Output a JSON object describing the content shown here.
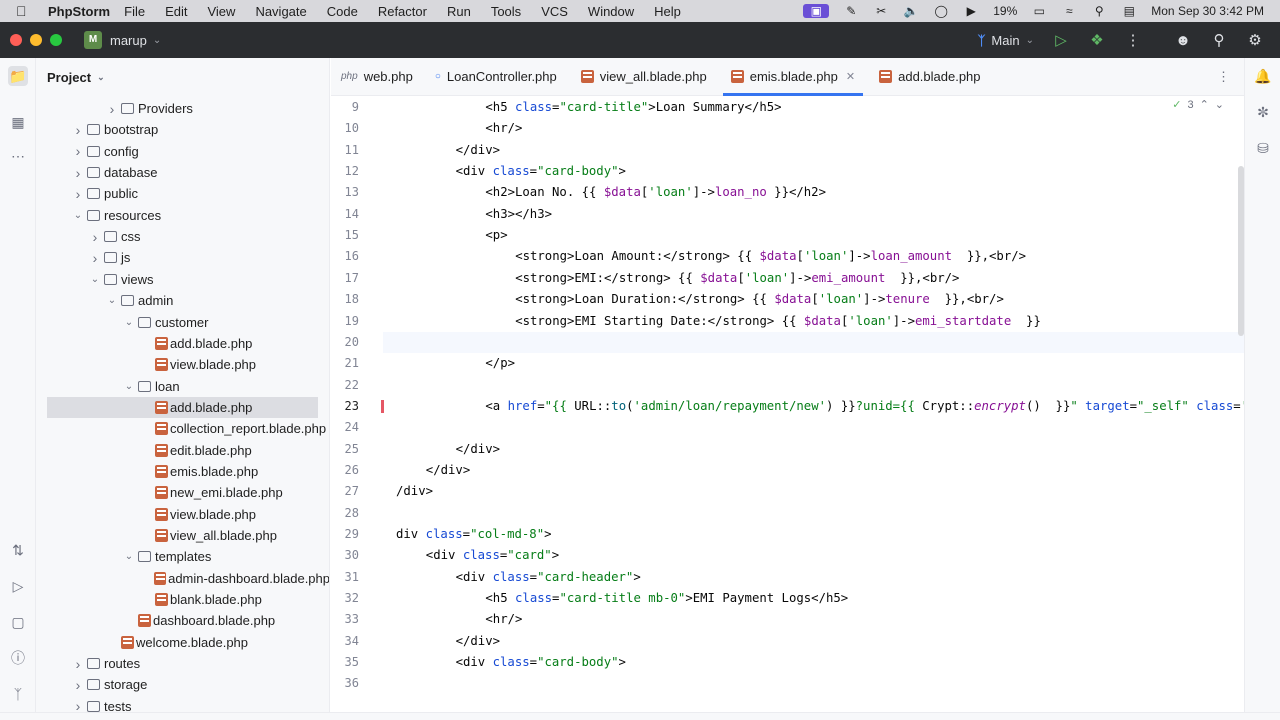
{
  "menubar": {
    "app_name": "PhpStorm",
    "items": [
      "File",
      "Edit",
      "View",
      "Navigate",
      "Code",
      "Refactor",
      "Run",
      "Tools",
      "VCS",
      "Window",
      "Help"
    ],
    "battery": "19%",
    "datetime": "Mon Sep 30  3:42 PM"
  },
  "titlebar": {
    "project_badge": "M",
    "project_name": "marup",
    "branch": "Main"
  },
  "project_panel": {
    "title": "Project",
    "tree": [
      {
        "label": "Providers",
        "kind": "folder",
        "depth": 3,
        "arrow": "closed"
      },
      {
        "label": "bootstrap",
        "kind": "folder",
        "depth": 1,
        "arrow": "closed"
      },
      {
        "label": "config",
        "kind": "folder",
        "depth": 1,
        "arrow": "closed"
      },
      {
        "label": "database",
        "kind": "folder",
        "depth": 1,
        "arrow": "closed"
      },
      {
        "label": "public",
        "kind": "folder",
        "depth": 1,
        "arrow": "closed"
      },
      {
        "label": "resources",
        "kind": "folder",
        "depth": 1,
        "arrow": "open"
      },
      {
        "label": "css",
        "kind": "folder",
        "depth": 2,
        "arrow": "closed"
      },
      {
        "label": "js",
        "kind": "folder",
        "depth": 2,
        "arrow": "closed"
      },
      {
        "label": "views",
        "kind": "folder",
        "depth": 2,
        "arrow": "open"
      },
      {
        "label": "admin",
        "kind": "folder",
        "depth": 3,
        "arrow": "open"
      },
      {
        "label": "customer",
        "kind": "folder",
        "depth": 4,
        "arrow": "open"
      },
      {
        "label": "add.blade.php",
        "kind": "blade",
        "depth": 5,
        "arrow": ""
      },
      {
        "label": "view.blade.php",
        "kind": "blade",
        "depth": 5,
        "arrow": ""
      },
      {
        "label": "loan",
        "kind": "folder",
        "depth": 4,
        "arrow": "open"
      },
      {
        "label": "add.blade.php",
        "kind": "blade",
        "depth": 5,
        "arrow": "",
        "selected": true
      },
      {
        "label": "collection_report.blade.php",
        "kind": "blade",
        "depth": 5,
        "arrow": ""
      },
      {
        "label": "edit.blade.php",
        "kind": "blade",
        "depth": 5,
        "arrow": ""
      },
      {
        "label": "emis.blade.php",
        "kind": "blade",
        "depth": 5,
        "arrow": ""
      },
      {
        "label": "new_emi.blade.php",
        "kind": "blade",
        "depth": 5,
        "arrow": ""
      },
      {
        "label": "view.blade.php",
        "kind": "blade",
        "depth": 5,
        "arrow": ""
      },
      {
        "label": "view_all.blade.php",
        "kind": "blade",
        "depth": 5,
        "arrow": ""
      },
      {
        "label": "templates",
        "kind": "folder",
        "depth": 4,
        "arrow": "open"
      },
      {
        "label": "admin-dashboard.blade.php",
        "kind": "blade",
        "depth": 5,
        "arrow": ""
      },
      {
        "label": "blank.blade.php",
        "kind": "blade",
        "depth": 5,
        "arrow": ""
      },
      {
        "label": "dashboard.blade.php",
        "kind": "blade",
        "depth": 4,
        "arrow": ""
      },
      {
        "label": "welcome.blade.php",
        "kind": "blade",
        "depth": 3,
        "arrow": ""
      },
      {
        "label": "routes",
        "kind": "folder",
        "depth": 1,
        "arrow": "closed"
      },
      {
        "label": "storage",
        "kind": "folder",
        "depth": 1,
        "arrow": "closed"
      },
      {
        "label": "tests",
        "kind": "folder",
        "depth": 1,
        "arrow": "closed"
      }
    ]
  },
  "tabs": [
    {
      "label": "web.php",
      "icon": "php",
      "active": false
    },
    {
      "label": "LoanController.php",
      "icon": "class",
      "active": false
    },
    {
      "label": "view_all.blade.php",
      "icon": "blade",
      "active": false
    },
    {
      "label": "emis.blade.php",
      "icon": "blade",
      "active": true
    },
    {
      "label": "add.blade.php",
      "icon": "blade",
      "active": false
    }
  ],
  "editor": {
    "inspection_count": "3",
    "lines": [
      {
        "n": "9",
        "indent": 6,
        "tokens": [
          [
            "tag",
            "<h5 "
          ],
          [
            "at",
            "class"
          ],
          [
            "tag",
            "="
          ],
          [
            "str",
            "\"card-title\""
          ],
          [
            "tag",
            ">Loan Summary</h5>"
          ]
        ]
      },
      {
        "n": "10",
        "indent": 6,
        "tokens": [
          [
            "tag",
            "<hr/>"
          ]
        ]
      },
      {
        "n": "11",
        "indent": 4,
        "tokens": [
          [
            "tag",
            "</div>"
          ]
        ]
      },
      {
        "n": "12",
        "indent": 4,
        "tokens": [
          [
            "tag",
            "<div "
          ],
          [
            "at",
            "class"
          ],
          [
            "tag",
            "="
          ],
          [
            "str",
            "\"card-body\""
          ],
          [
            "tag",
            ">"
          ]
        ]
      },
      {
        "n": "13",
        "indent": 6,
        "tokens": [
          [
            "tag",
            "<h2>Loan No. {{ "
          ],
          [
            "var",
            "$data"
          ],
          [
            "tag",
            "["
          ],
          [
            "str",
            "'loan'"
          ],
          [
            "tag",
            "]->"
          ],
          [
            "mth",
            "loan_no"
          ],
          [
            "tag",
            " }}</h2>"
          ]
        ]
      },
      {
        "n": "14",
        "indent": 6,
        "tokens": [
          [
            "tag",
            "<h3></h3>"
          ]
        ]
      },
      {
        "n": "15",
        "indent": 6,
        "tokens": [
          [
            "tag",
            "<p>"
          ]
        ]
      },
      {
        "n": "16",
        "indent": 8,
        "tokens": [
          [
            "tag",
            "<strong>Loan Amount:</strong> {{ "
          ],
          [
            "var",
            "$data"
          ],
          [
            "tag",
            "["
          ],
          [
            "str",
            "'loan'"
          ],
          [
            "tag",
            "]->"
          ],
          [
            "mth",
            "loan_amount"
          ],
          [
            "tag",
            "  }},<br/>"
          ]
        ]
      },
      {
        "n": "17",
        "indent": 8,
        "tokens": [
          [
            "tag",
            "<strong>EMI:</strong> {{ "
          ],
          [
            "var",
            "$data"
          ],
          [
            "tag",
            "["
          ],
          [
            "str",
            "'loan'"
          ],
          [
            "tag",
            "]->"
          ],
          [
            "mth",
            "emi_amount"
          ],
          [
            "tag",
            "  }},<br/>"
          ]
        ]
      },
      {
        "n": "18",
        "indent": 8,
        "tokens": [
          [
            "tag",
            "<strong>Loan Duration:</strong> {{ "
          ],
          [
            "var",
            "$data"
          ],
          [
            "tag",
            "["
          ],
          [
            "str",
            "'loan'"
          ],
          [
            "tag",
            "]->"
          ],
          [
            "mth",
            "tenure"
          ],
          [
            "tag",
            "  }},<br/>"
          ]
        ]
      },
      {
        "n": "19",
        "indent": 8,
        "tokens": [
          [
            "tag",
            "<strong>EMI Starting Date:</strong> {{ "
          ],
          [
            "var",
            "$data"
          ],
          [
            "tag",
            "["
          ],
          [
            "str",
            "'loan'"
          ],
          [
            "tag",
            "]->"
          ],
          [
            "mth",
            "emi_startdate"
          ],
          [
            "tag",
            "  }}"
          ]
        ]
      },
      {
        "n": "20",
        "indent": 0,
        "tokens": []
      },
      {
        "n": "21",
        "indent": 6,
        "tokens": [
          [
            "tag",
            "</p>"
          ]
        ]
      },
      {
        "n": "22",
        "indent": 0,
        "tokens": []
      },
      {
        "n": "23",
        "indent": 6,
        "tokens": [
          [
            "tag",
            "<a "
          ],
          [
            "at",
            "href"
          ],
          [
            "tag",
            "="
          ],
          [
            "str",
            "\"{{ "
          ],
          [
            "tag",
            "URL::"
          ],
          [
            "fn",
            "to"
          ],
          [
            "tag",
            "("
          ],
          [
            "str",
            "'admin/loan/repayment/new'"
          ],
          [
            "tag",
            ") }}"
          ],
          [
            "str",
            "?unid={{ "
          ],
          [
            "tag",
            "Crypt::"
          ],
          [
            "itl",
            "encrypt"
          ],
          [
            "tag",
            "()  }}"
          ],
          [
            "str",
            "\""
          ],
          [
            "tag",
            " "
          ],
          [
            "at",
            "target"
          ],
          [
            "tag",
            "="
          ],
          [
            "str",
            "\"_self\""
          ],
          [
            "tag",
            " "
          ],
          [
            "at",
            "class"
          ],
          [
            "tag",
            "="
          ],
          [
            "str",
            "'"
          ]
        ]
      },
      {
        "n": "24",
        "indent": 0,
        "tokens": []
      },
      {
        "n": "25",
        "indent": 4,
        "tokens": [
          [
            "tag",
            "</div>"
          ]
        ]
      },
      {
        "n": "26",
        "indent": 2,
        "tokens": [
          [
            "tag",
            "</div>"
          ]
        ]
      },
      {
        "n": "27",
        "indent": 0,
        "tokens": [
          [
            "tag",
            "/div>"
          ]
        ]
      },
      {
        "n": "28",
        "indent": 0,
        "tokens": []
      },
      {
        "n": "29",
        "indent": 0,
        "tokens": [
          [
            "tag",
            "div "
          ],
          [
            "at",
            "class"
          ],
          [
            "tag",
            "="
          ],
          [
            "str",
            "\"col-md-8\""
          ],
          [
            "tag",
            ">"
          ]
        ]
      },
      {
        "n": "30",
        "indent": 2,
        "tokens": [
          [
            "tag",
            "<div "
          ],
          [
            "at",
            "class"
          ],
          [
            "tag",
            "="
          ],
          [
            "str",
            "\"card\""
          ],
          [
            "tag",
            ">"
          ]
        ]
      },
      {
        "n": "31",
        "indent": 4,
        "tokens": [
          [
            "tag",
            "<div "
          ],
          [
            "at",
            "class"
          ],
          [
            "tag",
            "="
          ],
          [
            "str",
            "\"card-header\""
          ],
          [
            "tag",
            ">"
          ]
        ]
      },
      {
        "n": "32",
        "indent": 6,
        "tokens": [
          [
            "tag",
            "<h5 "
          ],
          [
            "at",
            "class"
          ],
          [
            "tag",
            "="
          ],
          [
            "str",
            "\"card-title mb-0\""
          ],
          [
            "tag",
            ">EMI Payment Logs</h5>"
          ]
        ]
      },
      {
        "n": "33",
        "indent": 6,
        "tokens": [
          [
            "tag",
            "<hr/>"
          ]
        ]
      },
      {
        "n": "34",
        "indent": 4,
        "tokens": [
          [
            "tag",
            "</div>"
          ]
        ]
      },
      {
        "n": "35",
        "indent": 4,
        "tokens": [
          [
            "tag",
            "<div "
          ],
          [
            "at",
            "class"
          ],
          [
            "tag",
            "="
          ],
          [
            "str",
            "\"card-body\""
          ],
          [
            "tag",
            ">"
          ]
        ]
      },
      {
        "n": "36",
        "indent": 0,
        "tokens": []
      }
    ]
  },
  "colors": {
    "accent": "#3574f0",
    "selection": "#dcdde2",
    "blade_icon": "#c9633e"
  }
}
